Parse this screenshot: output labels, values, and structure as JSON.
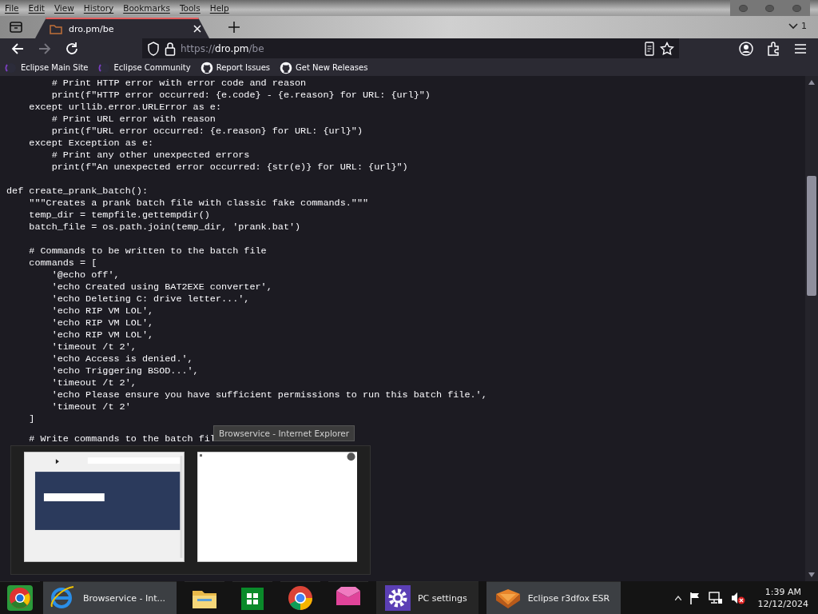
{
  "menu_bar": [
    "File",
    "Edit",
    "View",
    "History",
    "Bookmarks",
    "Tools",
    "Help"
  ],
  "tabs": [
    {
      "label": "dro.pm/be",
      "selected": true
    }
  ],
  "tab_list_count": "1",
  "address_bar": {
    "scheme": "https://",
    "host": "dro.pm",
    "path": "/be"
  },
  "bookmarks": [
    {
      "label": "Eclipse Main Site",
      "kind": "eclipse"
    },
    {
      "label": "Eclipse Community",
      "kind": "eclipse"
    },
    {
      "label": "Report Issues",
      "kind": "github"
    },
    {
      "label": "Get New Releases",
      "kind": "github"
    }
  ],
  "code": [
    "        # Print HTTP error with error code and reason\n        print(f\"HTTP error occurred: {e.code} - {e.reason} for URL: {url}\")\n    except urllib.error.URLError as e:\n        # Print URL error with reason\n        print(f\"URL error occurred: {e.reason} for URL: {url}\")\n    except Exception as e:\n        # Print any other unexpected errors\n        print(f\"An unexpected error occurred: {str(e)} for URL: {url}\")\n\ndef create_prank_batch():\n    \"\"\"Creates a prank batch file with classic fake commands.\"\"\"\n    temp_dir = tempfile.gettempdir()\n    batch_file = os.path.join(temp_dir, 'prank.bat')\n\n    # Commands to be written to the batch file\n    commands = [\n        '@echo off',\n        'echo Created using BAT2EXE converter',\n        'echo Deleting C: drive letter...',\n        'echo RIP VM LOL',\n        'echo RIP VM LOL',\n        'echo RIP VM LOL',\n        'timeout /t 2',\n        'echo Access is denied.',\n        'echo Triggering BSOD...',\n        'timeout /t 2',\n        'echo Please ensure you have sufficient permissions to run this batch file.',\n        'timeout /t 2'\n    ]",
    "    # Write commands to the batch fil"
  ],
  "preview_popup": {
    "title": "Browservice - Internet Explorer",
    "thumbnails": [
      {
        "kind": "login-page"
      },
      {
        "kind": "blank-page"
      }
    ]
  },
  "taskbar": {
    "items": [
      {
        "kind": "chromium",
        "active": false
      },
      {
        "kind": "ie",
        "label": "Browservice - Int...",
        "active": true
      },
      {
        "kind": "folder",
        "active": false
      },
      {
        "kind": "store",
        "active": false
      },
      {
        "kind": "chrome",
        "active": false
      },
      {
        "kind": "pink",
        "active": false
      },
      {
        "kind": "gear",
        "label": "PC settings",
        "active": false
      },
      {
        "kind": "fox",
        "label": "Eclipse r3dfox ESR",
        "active": true
      }
    ],
    "clock": {
      "time": "1:39 AM",
      "date": "12/12/2024"
    }
  }
}
